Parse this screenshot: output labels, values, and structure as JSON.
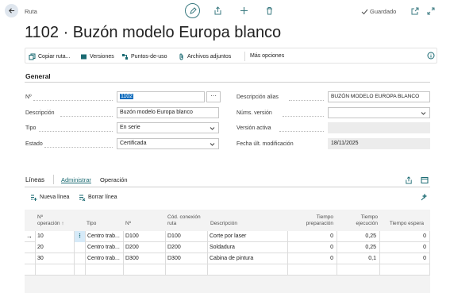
{
  "header": {
    "breadcrumb": "Ruta",
    "saved_label": "Guardado",
    "title": "1102 · Buzón modelo Europa blanco"
  },
  "actions": [
    {
      "label": "Copiar ruta...",
      "icon": "copy-icon"
    },
    {
      "label": "Versiones",
      "icon": "book-icon"
    },
    {
      "label": "Puntos-de-uso",
      "icon": "where-used-icon"
    },
    {
      "label": "Archivos adjuntos",
      "icon": "paperclip-icon"
    },
    {
      "label": "Más opciones",
      "icon": ""
    }
  ],
  "general": {
    "section_title": "General",
    "no_label": "Nº",
    "no_value": "1102",
    "descripcion_label": "Descripción",
    "descripcion_value": "Buzón modelo Europa blanco",
    "tipo_label": "Tipo",
    "tipo_value": "En serie",
    "estado_label": "Estado",
    "estado_value": "Certificada",
    "alias_label": "Descripción alias",
    "alias_value": "BUZÓN MODELO EUROPA BLANCO",
    "nums_version_label": "Núms. versión",
    "nums_version_value": "",
    "version_activa_label": "Versión activa",
    "version_activa_value": "",
    "fecha_label": "Fecha últ. modificación",
    "fecha_value": "18/11/2025"
  },
  "lines": {
    "title": "Líneas",
    "tabs": [
      "Administrar",
      "Operación"
    ],
    "nueva_linea": "Nueva línea",
    "borrar_linea": "Borrar línea",
    "columns": {
      "operacion": [
        "Nº",
        "operación ↑"
      ],
      "tipo": "Tipo",
      "no": "Nº",
      "cod_conexion": [
        "Cód. conexión",
        "ruta"
      ],
      "descripcion": "Descripción",
      "tiempo_preparacion": [
        "Tiempo",
        "preparación"
      ],
      "tiempo_ejecucion": [
        "Tiempo",
        "ejecución"
      ],
      "tiempo_espera": "Tiempo espera"
    },
    "rows": [
      {
        "operacion": "10",
        "tipo": "Centro trab...",
        "no": "D100",
        "cod": "D100",
        "descripcion": "Corte por laser",
        "prep": "0",
        "ejec": "0,25",
        "espera": "0"
      },
      {
        "operacion": "20",
        "tipo": "Centro trab...",
        "no": "D200",
        "cod": "D200",
        "descripcion": "Soldadura",
        "prep": "0",
        "ejec": "0,25",
        "espera": "0"
      },
      {
        "operacion": "30",
        "tipo": "Centro trab...",
        "no": "D300",
        "cod": "D300",
        "descripcion": "Cabina de pintura",
        "prep": "0",
        "ejec": "0,1",
        "espera": "0"
      }
    ]
  },
  "colors": {
    "accent": "#1a6a72",
    "selection": "#0f6cbd",
    "grid_bg": "#f3f3f3"
  }
}
